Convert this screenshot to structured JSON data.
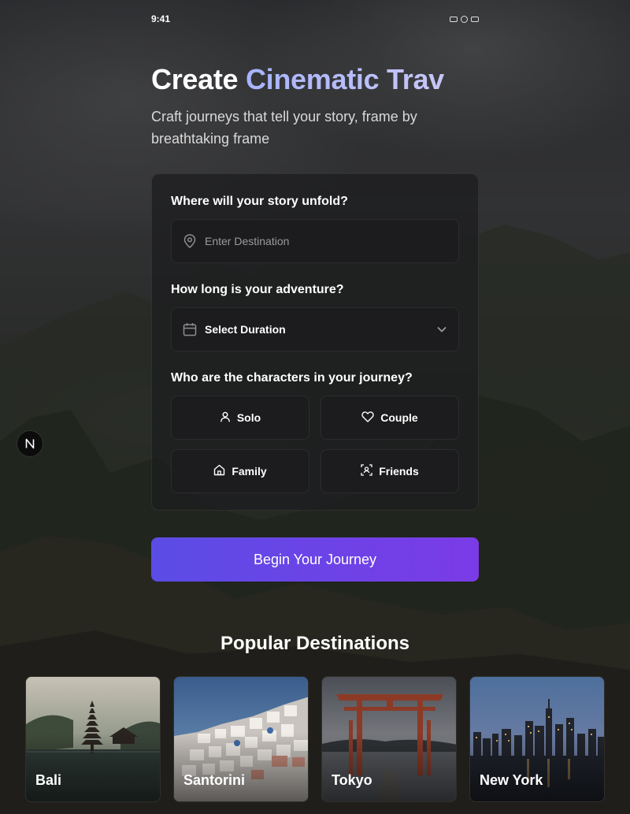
{
  "status": {
    "time": "9:41"
  },
  "hero": {
    "title_plain": "Create ",
    "title_accent": "Cinematic Trav",
    "subtitle": "Craft journeys that tell your story, frame by breathtaking frame"
  },
  "form": {
    "destination": {
      "label": "Where will your story unfold?",
      "placeholder": "Enter Destination"
    },
    "duration": {
      "label": "How long is your adventure?",
      "selected": "Select Duration"
    },
    "travelers": {
      "label": "Who are the characters in your journey?",
      "options": [
        {
          "label": "Solo",
          "icon": "person-icon"
        },
        {
          "label": "Couple",
          "icon": "heart-icon"
        },
        {
          "label": "Family",
          "icon": "home-icon"
        },
        {
          "label": "Friends",
          "icon": "group-scan-icon"
        }
      ]
    }
  },
  "cta": {
    "label": "Begin Your Journey"
  },
  "popular": {
    "title": "Popular Destinations",
    "items": [
      {
        "name": "Bali"
      },
      {
        "name": "Santorini"
      },
      {
        "name": "Tokyo"
      },
      {
        "name": "New York"
      }
    ]
  },
  "theme": {
    "accent_start": "#5b4ce6",
    "accent_end": "#7b3be6",
    "card_bg": "#1c1c1e"
  }
}
